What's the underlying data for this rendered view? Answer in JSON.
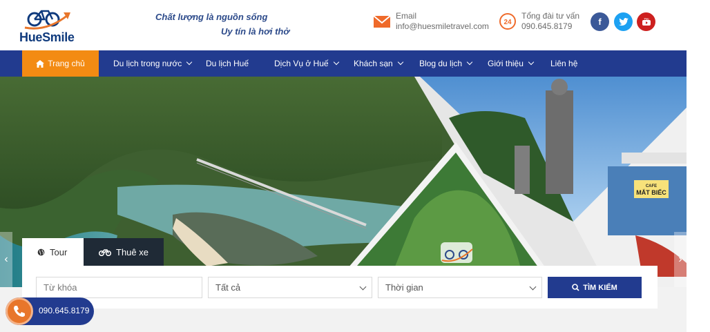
{
  "header": {
    "logo_text": "HueSmile",
    "slogan_line1": "Chất lượng là nguồn sống",
    "slogan_line2": "Uy tín là hơi thở",
    "email_label": "Email",
    "email_value": "info@huesmiletravel.com",
    "hotline_label": "Tổng đài tư vấn",
    "hotline_value": "090.645.8179",
    "hotline_badge": "24",
    "social": [
      {
        "name": "facebook-icon",
        "glyph": "f",
        "color": "#3b5998"
      },
      {
        "name": "twitter-icon",
        "glyph": "t",
        "color": "#1da1f2"
      },
      {
        "name": "youtube-icon",
        "glyph": "▶",
        "color": "#cd201f"
      }
    ]
  },
  "nav": {
    "home": "Trang chủ",
    "items": [
      {
        "label": "Du lịch trong nước",
        "dropdown": true
      },
      {
        "label": "Du lịch Huế",
        "dropdown": false
      },
      {
        "label": "Dịch Vụ ở Huế",
        "dropdown": true
      },
      {
        "label": "Khách sạn",
        "dropdown": true
      },
      {
        "label": "Blog du lịch",
        "dropdown": true
      },
      {
        "label": "Giới thiệu",
        "dropdown": true
      },
      {
        "label": "Liên hệ",
        "dropdown": false
      }
    ]
  },
  "hero": {
    "cafe_sign_top": "CAFE",
    "cafe_sign_main": "MẮT BIẾC"
  },
  "search": {
    "tab_tour": "Tour",
    "tab_car": "Thuê xe",
    "keyword_placeholder": "Từ khóa",
    "category_selected": "Tất cả",
    "time_selected": "Thời gian",
    "button_label": "TÌM KIẾM"
  },
  "floating": {
    "phone": "090.645.8179"
  },
  "colors": {
    "nav_bg": "#223b8f",
    "home_accent": "#f38b13",
    "tab_dark": "#1f2a36"
  }
}
